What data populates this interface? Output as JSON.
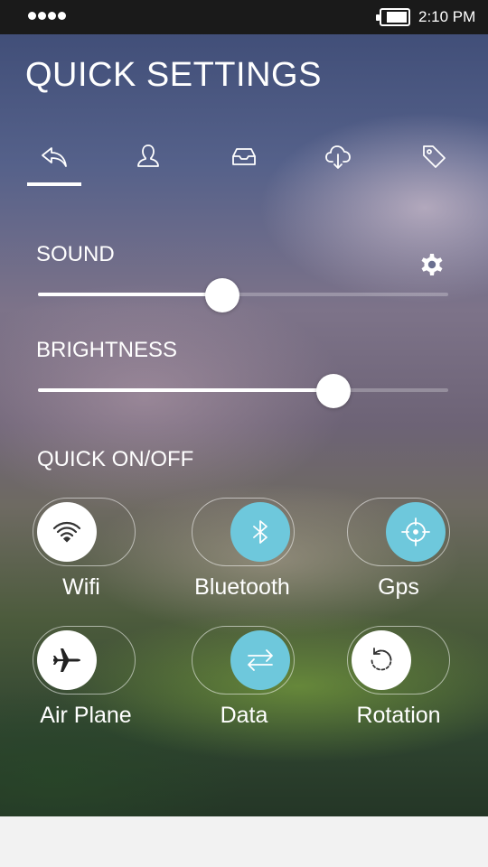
{
  "status": {
    "time": "2:10 PM"
  },
  "header": {
    "title": "QUICK SETTINGS"
  },
  "tabs": [
    {
      "icon": "reply-icon",
      "active": true
    },
    {
      "icon": "user-icon",
      "active": false
    },
    {
      "icon": "inbox-icon",
      "active": false
    },
    {
      "icon": "cloud-download-icon",
      "active": false
    },
    {
      "icon": "tag-icon",
      "active": false
    }
  ],
  "sound": {
    "label": "SOUND",
    "level": 0.45
  },
  "brightness": {
    "label": "BRIGHTNESS",
    "level": 0.72
  },
  "quick": {
    "label": "QUICK ON/OFF",
    "toggles": [
      {
        "label": "Wifi",
        "on": false,
        "icon": "wifi-icon"
      },
      {
        "label": "Bluetooth",
        "on": true,
        "icon": "bluetooth-icon"
      },
      {
        "label": "Gps",
        "on": true,
        "icon": "gps-icon"
      },
      {
        "label": "Air Plane",
        "on": false,
        "icon": "airplane-icon"
      },
      {
        "label": "Data",
        "on": true,
        "icon": "data-transfer-icon"
      },
      {
        "label": "Rotation",
        "on": false,
        "icon": "rotation-icon"
      }
    ]
  },
  "colors": {
    "toggle_on": "#6ec8dc",
    "toggle_off": "#ffffff",
    "status_bar": "#1a1a1a"
  }
}
